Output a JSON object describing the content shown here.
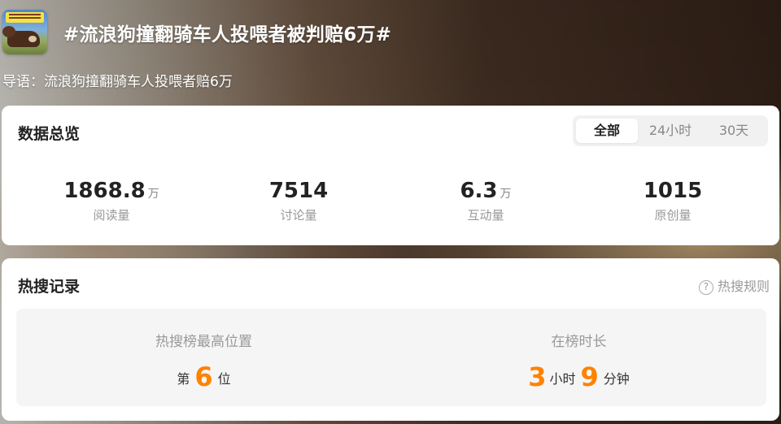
{
  "header": {
    "title": "#流浪狗撞翻骑车人投喂者被判赔6万#",
    "guide": "导语：流浪狗撞翻骑车人投喂者赔6万"
  },
  "overview": {
    "title": "数据总览",
    "tabs": [
      {
        "label": "全部",
        "active": true
      },
      {
        "label": "24小时",
        "active": false
      },
      {
        "label": "30天",
        "active": false
      }
    ],
    "metrics": [
      {
        "value": "1868.8",
        "unit": "万",
        "label": "阅读量"
      },
      {
        "value": "7514",
        "unit": "",
        "label": "讨论量"
      },
      {
        "value": "6.3",
        "unit": "万",
        "label": "互动量"
      },
      {
        "value": "1015",
        "unit": "",
        "label": "原创量"
      }
    ]
  },
  "hot_search": {
    "title": "热搜记录",
    "rules_label": "热搜规则",
    "help_icon": "?",
    "peak": {
      "heading": "热搜榜最高位置",
      "prefix": "第",
      "value": "6",
      "suffix": "位"
    },
    "duration": {
      "heading": "在榜时长",
      "hours": "3",
      "hours_unit": "小时",
      "minutes": "9",
      "minutes_unit": "分钟"
    }
  },
  "colors": {
    "accent": "#ff8200",
    "card_bg": "#ffffff",
    "record_bg": "#f5f5f5"
  }
}
